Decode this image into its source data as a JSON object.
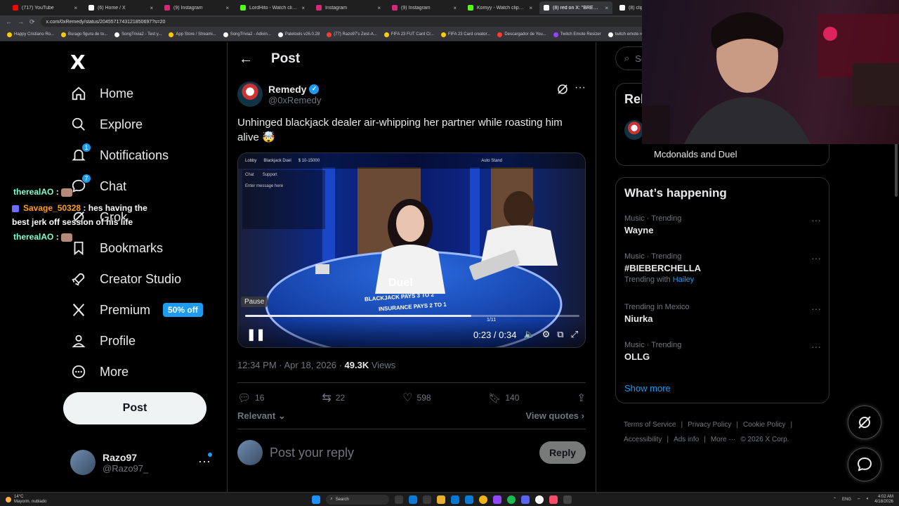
{
  "browser": {
    "tabs": [
      {
        "label": "(717) YouTube",
        "color": "#ff0000",
        "active": false
      },
      {
        "label": "(6) Home / X",
        "color": "#ffffff",
        "active": false
      },
      {
        "label": "(9) Instagram",
        "color": "#d62976",
        "active": false
      },
      {
        "label": "LordHito - Watch clips on X",
        "color": "#53fc18",
        "active": false
      },
      {
        "label": "Instagram",
        "color": "#d62976",
        "active": false
      },
      {
        "label": "(9) Instagram",
        "color": "#d62976",
        "active": false
      },
      {
        "label": "Komyy - Watch clips on X",
        "color": "#53fc18",
        "active": false
      },
      {
        "label": "(8) red on X: \"BREAKING",
        "color": "#ffffff",
        "active": true
      },
      {
        "label": "(8) clip on X",
        "color": "#ffffff",
        "active": false
      }
    ],
    "url": "x.com/0xRemedy/status/2045571743121850697?s=20",
    "bookmarks": [
      {
        "label": "Happy Cristiano Ro...",
        "color": "#ffcc00"
      },
      {
        "label": "Burago figura de to...",
        "color": "#ffcc00"
      },
      {
        "label": "SongTrivia2 - Test y...",
        "color": "#ffffff"
      },
      {
        "label": "App Store / Streami...",
        "color": "#ffcc00"
      },
      {
        "label": "SongTrivia2 - Adivin...",
        "color": "#ffffff"
      },
      {
        "label": "Paletools v26.0.28",
        "color": "#ffffff"
      },
      {
        "label": "(77) Razo97's Zest-A...",
        "color": "#ff3b30"
      },
      {
        "label": "FIFA 23 FUT Card Cr...",
        "color": "#ffcc00"
      },
      {
        "label": "FIFA 23 Card creator...",
        "color": "#ffcc00"
      },
      {
        "label": "Descargador de You...",
        "color": "#ff3b30"
      },
      {
        "label": "Twitch Emote Resizer",
        "color": "#9146ff"
      },
      {
        "label": "twitch emote re",
        "color": "#ffffff"
      }
    ]
  },
  "nav": {
    "logo": "X",
    "items": [
      {
        "label": "Home",
        "icon": "home-icon"
      },
      {
        "label": "Explore",
        "icon": "search-icon"
      },
      {
        "label": "Notifications",
        "icon": "bell-icon",
        "badge": "1"
      },
      {
        "label": "Chat",
        "icon": "chat-icon",
        "badge": "7"
      },
      {
        "label": "Grok",
        "icon": "grok-icon"
      },
      {
        "label": "Bookmarks",
        "icon": "bookmark-icon"
      },
      {
        "label": "Creator Studio",
        "icon": "rocket-icon"
      },
      {
        "label": "Premium",
        "icon": "x-icon",
        "tag": "50% off"
      },
      {
        "label": "Profile",
        "icon": "person-icon"
      },
      {
        "label": "More",
        "icon": "more-circle-icon"
      }
    ],
    "post_label": "Post",
    "account": {
      "name": "Razo97",
      "handle": "@Razo97_"
    }
  },
  "chat_overlay": {
    "lines": [
      {
        "user": "therealAO",
        "user_color": "#7fffd4",
        "text": ""
      },
      {
        "user": "Savage_50328",
        "user_color": "#ff9f1a",
        "text": "hes having the"
      },
      {
        "user": "",
        "user_color": "#ffffff",
        "text": "best jerk off session of his life"
      },
      {
        "user": "therealAO",
        "user_color": "#7fffd4",
        "text": ""
      }
    ]
  },
  "post": {
    "header_title": "Post",
    "author": {
      "name": "Remedy",
      "handle": "@0xRemedy"
    },
    "text": "Unhinged blackjack dealer air-whipping her partner while roasting him alive",
    "emoji": "🤯",
    "video": {
      "pause_tooltip": "Pause",
      "time": "0:23 / 0:34",
      "progress": 0.676,
      "overlay": {
        "lobby": "Lobby",
        "game": "Blackjack Duel",
        "limits": "$ 10-15000",
        "auto_stand": "Auto Stand",
        "chat": "Chat",
        "support": "Support",
        "message_placeholder": "Enter message here",
        "table_text": "BLACKJACK PAYS 3 TO 2",
        "insurance_text": "INSURANCE PAYS 2 TO 1",
        "brand": "Duel",
        "shoe_count": "1/11"
      }
    },
    "timestamp": "12:34 PM · Apr 18, 2026",
    "dot": "·",
    "views_count": "49.3K",
    "views_label": "Views",
    "stats": {
      "replies": "16",
      "reposts": "22",
      "likes": "598",
      "bookmarks": "140"
    },
    "relevant": "Relevant",
    "view_quotes": "View quotes",
    "reply_placeholder": "Post your reply",
    "reply_button": "Reply"
  },
  "sidebar": {
    "search_placeholder": "Search",
    "relevant_title": "Relevant people",
    "relevant_bio": "Mcdonalds and Duel",
    "trends_title": "What’s happening",
    "trends": [
      {
        "meta": "Music · Trending",
        "name": "Wayne",
        "with": ""
      },
      {
        "meta": "Music · Trending",
        "name": "#BIEBERCHELLA",
        "with": "Hailey"
      },
      {
        "meta": "Trending in Mexico",
        "name": "Niurka",
        "with": ""
      },
      {
        "meta": "Music · Trending",
        "name": "OLLG",
        "with": ""
      }
    ],
    "trending_with_label": "Trending with",
    "show_more": "Show more",
    "footer": [
      "Terms of Service",
      "|",
      "Privacy Policy",
      "|",
      "Cookie Policy",
      "|",
      "Accessibility",
      "|",
      "Ads info",
      "|",
      "More ···",
      "© 2026 X Corp."
    ]
  },
  "taskbar": {
    "weather_temp": "14°C",
    "weather_text": "Mayorm. nublado",
    "search": "Search",
    "lang": "ENG",
    "time": "4:02 AM",
    "date": "4/18/2026"
  },
  "colors": {
    "accent": "#1d9bf0",
    "bg": "#000000",
    "border": "#2f3336",
    "muted": "#71767b"
  }
}
